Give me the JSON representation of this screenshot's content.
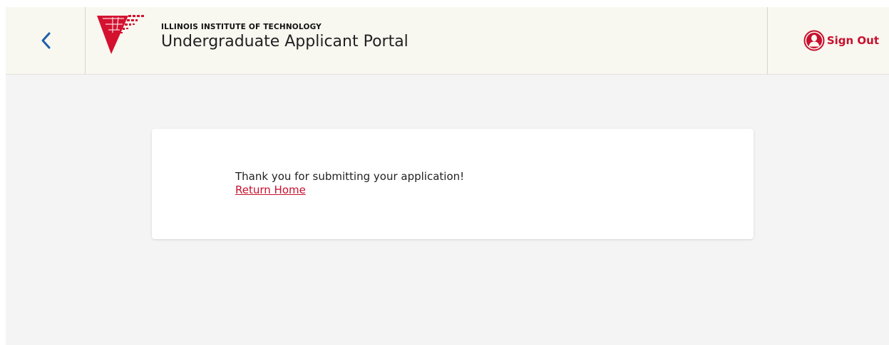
{
  "header": {
    "back_icon": "chevron-left-icon",
    "logo_icon": "iit-logo-icon",
    "institution": "ILLINOIS INSTITUTE OF TECHNOLOGY",
    "portal_title": "Undergraduate Applicant Portal",
    "sign_out": {
      "icon": "user-circle-icon",
      "label": "Sign Out"
    }
  },
  "main": {
    "message": "Thank you for submitting your application!",
    "return_link": "Return Home"
  },
  "colors": {
    "accent_red": "#c8102e",
    "back_blue": "#1f5fa8",
    "header_bg": "#f8f7f0",
    "page_bg": "#f4f4f4"
  }
}
